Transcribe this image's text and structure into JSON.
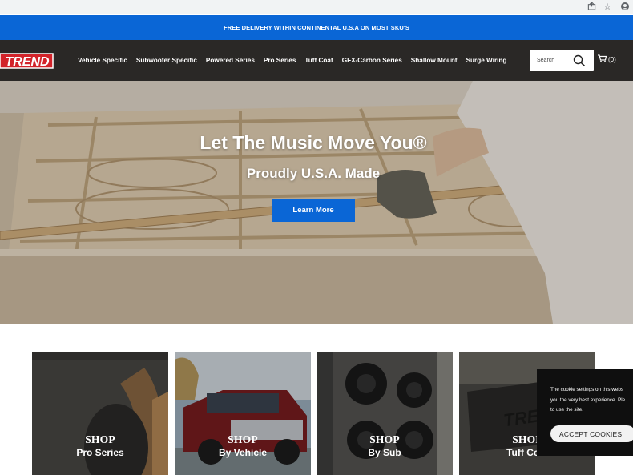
{
  "browser": {
    "icons": [
      "share-icon",
      "star-icon",
      "profile-icon"
    ]
  },
  "promo": {
    "text": "FREE DELIVERY WITHIN CONTINENTAL U.S.A ON MOST SKU'S"
  },
  "header": {
    "logo_text": "TREND",
    "nav": [
      {
        "label": "Vehicle Specific"
      },
      {
        "label": "Subwoofer Specific"
      },
      {
        "label": "Powered Series"
      },
      {
        "label": "Pro Series"
      },
      {
        "label": "Tuff Coat"
      },
      {
        "label": "GFX-Carbon Series"
      },
      {
        "label": "Shallow Mount"
      },
      {
        "label": "Surge Wiring"
      }
    ],
    "search": {
      "placeholder": "Search",
      "value": ""
    },
    "cart": {
      "icon": "cart-icon",
      "count_label": "(0)"
    }
  },
  "hero": {
    "title": "Let The Music Move You®",
    "subtitle": "Proudly U.S.A. Made",
    "cta_label": "Learn More"
  },
  "shop_cards": [
    {
      "prefix": "SHOP",
      "label": "Pro Series"
    },
    {
      "prefix": "SHOP",
      "label": "By Vehicle"
    },
    {
      "prefix": "SHOP",
      "label": "By Sub"
    },
    {
      "prefix": "SHOP",
      "label": "Tuff Coat"
    }
  ],
  "cookie": {
    "line1": "The cookie settings on this webs",
    "line2": "you the very best experience. Ple",
    "line3": "to use the site.",
    "accept_label": "ACCEPT COOKIES"
  },
  "colors": {
    "accent": "#0a66d6",
    "nav_bg": "#2a2826",
    "logo_red": "#d2232a"
  }
}
